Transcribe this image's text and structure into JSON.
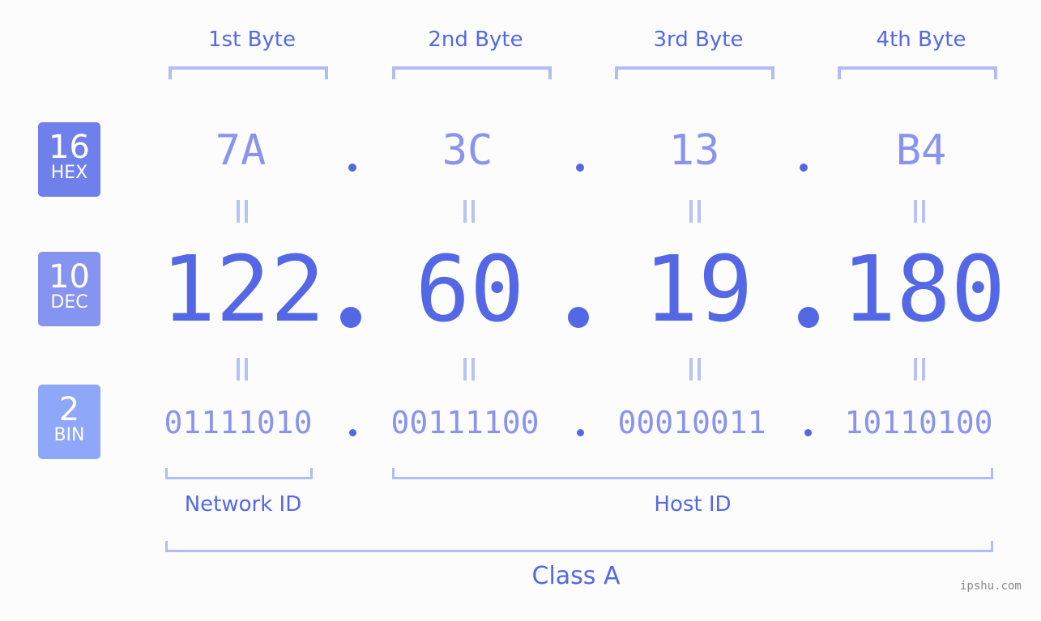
{
  "colors": {
    "hex_badge": "#6f80ea",
    "dec_badge": "#8593f1",
    "bin_badge": "#8ea7f8",
    "accent": "#5468e6",
    "light": "#8a94ee",
    "bracket": "#b2bcf6"
  },
  "badges": [
    {
      "num": "16",
      "label": "HEX"
    },
    {
      "num": "10",
      "label": "DEC"
    },
    {
      "num": "2",
      "label": "BIN"
    }
  ],
  "bytes": [
    {
      "label": "1st Byte",
      "hex": "7A",
      "dec": "122",
      "bin": "01111010"
    },
    {
      "label": "2nd Byte",
      "hex": "3C",
      "dec": "60",
      "bin": "00111100"
    },
    {
      "label": "3rd Byte",
      "hex": "13",
      "dec": "19",
      "bin": "00010011"
    },
    {
      "label": "4th Byte",
      "hex": "B4",
      "dec": "180",
      "bin": "10110100"
    }
  ],
  "network_id": "Network ID",
  "host_id": "Host ID",
  "class": "Class A",
  "watermark": "ipshu.com"
}
